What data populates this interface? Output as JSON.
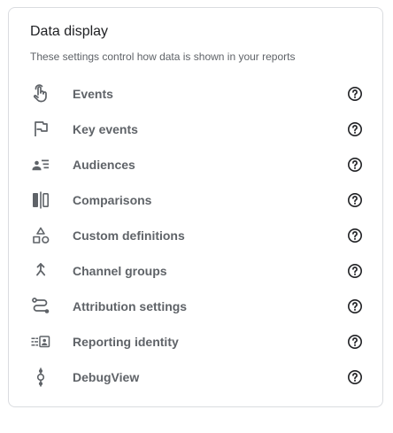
{
  "section": {
    "title": "Data display",
    "subtitle": "These settings control how data is shown in your reports"
  },
  "items": [
    {
      "label": "Events",
      "icon": "touch-icon"
    },
    {
      "label": "Key events",
      "icon": "flag-icon"
    },
    {
      "label": "Audiences",
      "icon": "audience-icon"
    },
    {
      "label": "Comparisons",
      "icon": "comparisons-icon"
    },
    {
      "label": "Custom definitions",
      "icon": "shapes-icon"
    },
    {
      "label": "Channel groups",
      "icon": "merge-icon"
    },
    {
      "label": "Attribution settings",
      "icon": "route-icon"
    },
    {
      "label": "Reporting identity",
      "icon": "identity-icon"
    },
    {
      "label": "DebugView",
      "icon": "debug-icon"
    }
  ],
  "help_icon": "help-circle-icon",
  "colors": {
    "icon": "#5f6368",
    "label": "#5f6368",
    "title": "#202124",
    "border": "#dadce0"
  }
}
